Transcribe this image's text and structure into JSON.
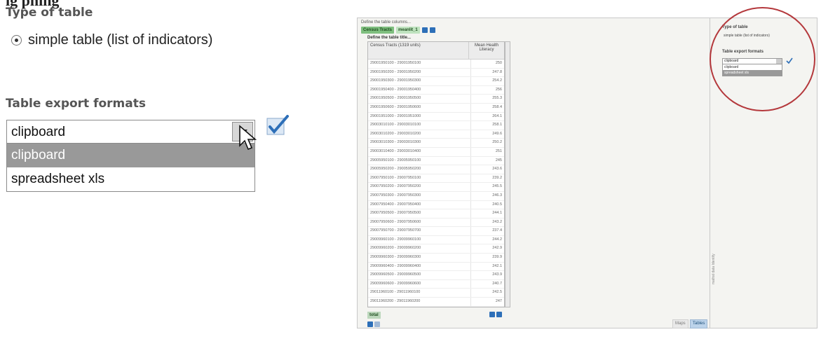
{
  "inset": {
    "cut_title": "ig      phing",
    "type_of_table_heading": "Type of table",
    "radio_label": "simple table (list of indicators)",
    "export_heading": "Table export formats",
    "select_value": "clipboard",
    "options": [
      "clipboard",
      "spreadsheet xls"
    ]
  },
  "screenshot": {
    "define_columns": "Define the table columns...",
    "chip_1": "Census Tracts",
    "chip_2": "meanlit_1",
    "define_title": "Define the table title...",
    "col_1_header": "Census Tracts (1319 units)",
    "col_2_header": "Mean Health Literacy",
    "rows": [
      {
        "tract": "29001950100 - 29001950100",
        "value": "250"
      },
      {
        "tract": "29001950200 - 29001950200",
        "value": "247.8"
      },
      {
        "tract": "29001950300 - 29001950300",
        "value": "254.2"
      },
      {
        "tract": "29001950400 - 29001950400",
        "value": "256"
      },
      {
        "tract": "29001950500 - 29001950500",
        "value": "255.3"
      },
      {
        "tract": "29001950600 - 29001950600",
        "value": "258.4"
      },
      {
        "tract": "29001951000 - 29001951000",
        "value": "264.1"
      },
      {
        "tract": "29003010100 - 29003010100",
        "value": "258.1"
      },
      {
        "tract": "29003010200 - 29003010200",
        "value": "249.6"
      },
      {
        "tract": "29003010300 - 29003010300",
        "value": "250.2"
      },
      {
        "tract": "29003010400 - 29003010400",
        "value": "251"
      },
      {
        "tract": "29005950100 - 29005950100",
        "value": "245"
      },
      {
        "tract": "29005950200 - 29005950200",
        "value": "243.6"
      },
      {
        "tract": "29007950100 - 29007950100",
        "value": "239.2"
      },
      {
        "tract": "29007950200 - 29007950200",
        "value": "245.5"
      },
      {
        "tract": "29007950300 - 29007950300",
        "value": "246.3"
      },
      {
        "tract": "29007950400 - 29007950400",
        "value": "240.5"
      },
      {
        "tract": "29007950500 - 29007950500",
        "value": "244.1"
      },
      {
        "tract": "29007950600 - 29007950600",
        "value": "243.2"
      },
      {
        "tract": "29007950700 - 29007950700",
        "value": "237.4"
      },
      {
        "tract": "29009960100 - 29009960100",
        "value": "244.2"
      },
      {
        "tract": "29009960200 - 29009960200",
        "value": "242.9"
      },
      {
        "tract": "29009960300 - 29009960300",
        "value": "239.9"
      },
      {
        "tract": "29009960400 - 29009960400",
        "value": "242.1"
      },
      {
        "tract": "29009960500 - 29009960500",
        "value": "243.9"
      },
      {
        "tract": "29009960600 - 29009960600",
        "value": "240.7"
      },
      {
        "tract": "29011960100 - 29011960100",
        "value": "242.5"
      },
      {
        "tract": "29011960200 - 29011960200",
        "value": "247"
      },
      {
        "tract": "29011960300 - 29011960300",
        "value": "243.3"
      }
    ],
    "total_label": "total",
    "tab_maps": "Maps",
    "tab_tables": "Tables",
    "vertical_label": "mathst data Identify",
    "mini_type_heading": "Type of table",
    "mini_radio_label": "simple table (list of indicators)",
    "mini_export_heading": "Table export formats",
    "mini_select_value": "clipboard",
    "mini_options": [
      "clipboard",
      "spreadsheet xls"
    ]
  },
  "colors": {
    "accent_blue": "#2d6fb8",
    "chip_green": "#7fbf7f",
    "highlight_red": "#b4383c",
    "selected_option_gray": "#999999"
  }
}
